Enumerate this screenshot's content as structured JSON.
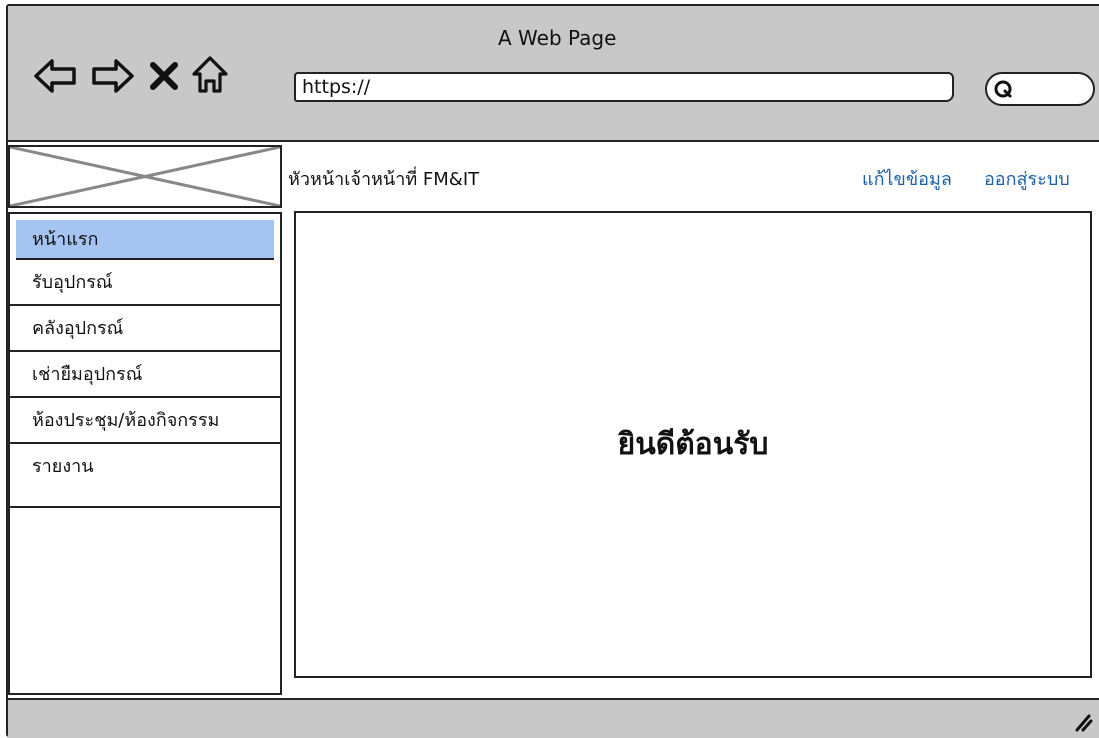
{
  "browser": {
    "title": "A Web Page",
    "url": "https://",
    "icons": [
      "back-arrow-icon",
      "forward-arrow-icon",
      "close-icon",
      "home-icon",
      "search-icon"
    ]
  },
  "header": {
    "role_label": "หัวหน้าเจ้าหน้าที่ FM&IT",
    "edit_link": "แก้ไขข้อมูล",
    "logout_link": "ออกสู่ระบบ"
  },
  "sidebar": {
    "items": [
      {
        "label": "หน้าแรก",
        "active": true
      },
      {
        "label": "รับอุปกรณ์",
        "active": false
      },
      {
        "label": "คลังอุปกรณ์",
        "active": false
      },
      {
        "label": "เช่ายืมอุปกรณ์",
        "active": false
      },
      {
        "label": "ห้องประชุม/ห้องกิจกรรม",
        "active": false
      },
      {
        "label": "รายงาน",
        "active": false
      }
    ]
  },
  "main": {
    "welcome_text": "ยินดีต้อนรับ"
  },
  "colors": {
    "chrome": "#c8c8c8",
    "active_menu": "#a6c4f2",
    "link": "#1e5fa8"
  }
}
